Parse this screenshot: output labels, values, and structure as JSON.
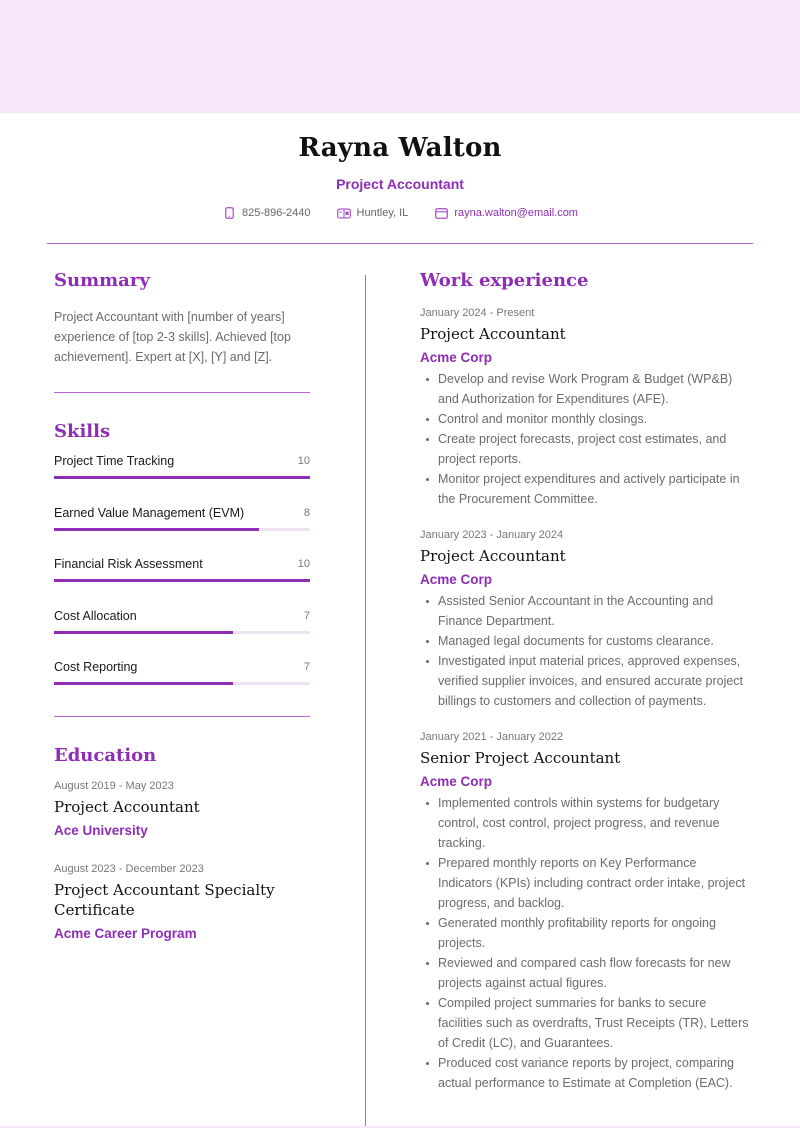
{
  "header": {
    "name": "Rayna Walton",
    "role": "Project Accountant",
    "contacts": [
      {
        "icon": "phone-icon",
        "text": "825-896-2440"
      },
      {
        "icon": "location-card-icon",
        "text": "Huntley, IL"
      },
      {
        "icon": "email-icon",
        "text": "rayna.walton@email.com"
      }
    ]
  },
  "colors": {
    "accent": "#8e2db5",
    "band": "#f6e6fa",
    "divider": "#b565cf",
    "skill_track": "#ede3f1"
  },
  "summary": {
    "title": "Summary",
    "text": "Project Accountant with [number of years] experience of [top 2-3 skills]. Achieved [top achievement]. Expert at [X], [Y] and [Z]."
  },
  "skills": {
    "title": "Skills",
    "max": 10,
    "items": [
      {
        "name": "Project Time Tracking",
        "level": 10
      },
      {
        "name": "Earned Value Management (EVM)",
        "level": 8
      },
      {
        "name": "Financial Risk Assessment",
        "level": 10
      },
      {
        "name": "Cost Allocation",
        "level": 7
      },
      {
        "name": "Cost Reporting",
        "level": 7
      }
    ]
  },
  "education": {
    "title": "Education",
    "items": [
      {
        "date": "August 2019 - May 2023",
        "title": "Project Accountant",
        "org": "Ace University"
      },
      {
        "date": "August 2023 - December 2023",
        "title": "Project Accountant Specialty Certificate",
        "org": "Acme Career Program"
      }
    ]
  },
  "work": {
    "title": "Work experience",
    "items": [
      {
        "date": "January 2024 - Present",
        "title": "Project Accountant",
        "org": "Acme Corp",
        "bullets": [
          "Develop and revise Work Program & Budget (WP&B) and Authorization for Expenditures (AFE).",
          "Control and monitor monthly closings.",
          "Create project forecasts, project cost estimates, and project reports.",
          "Monitor project expenditures and actively participate in the Procurement Committee."
        ]
      },
      {
        "date": "January 2023 - January 2024",
        "title": "Project Accountant",
        "org": "Acme Corp",
        "bullets": [
          "Assisted Senior Accountant in the Accounting and Finance Department.",
          "Managed legal documents for customs clearance.",
          "Investigated input material prices, approved expenses, verified supplier invoices, and ensured accurate project billings to customers and collection of payments."
        ]
      },
      {
        "date": "January 2021 - January 2022",
        "title": "Senior Project Accountant",
        "org": "Acme Corp",
        "bullets": [
          "Implemented controls within systems for budgetary control, cost control, project progress, and revenue tracking.",
          "Prepared monthly reports on Key Performance Indicators (KPIs) including contract order intake, project progress, and backlog.",
          "Generated monthly profitability reports for ongoing projects.",
          "Reviewed and compared cash flow forecasts for new projects against actual figures.",
          "Compiled project summaries for banks to secure facilities such as overdrafts, Trust Receipts (TR), Letters of Credit (LC), and Guarantees.",
          "Produced cost variance reports by project, comparing actual performance to Estimate at Completion (EAC)."
        ]
      }
    ]
  }
}
